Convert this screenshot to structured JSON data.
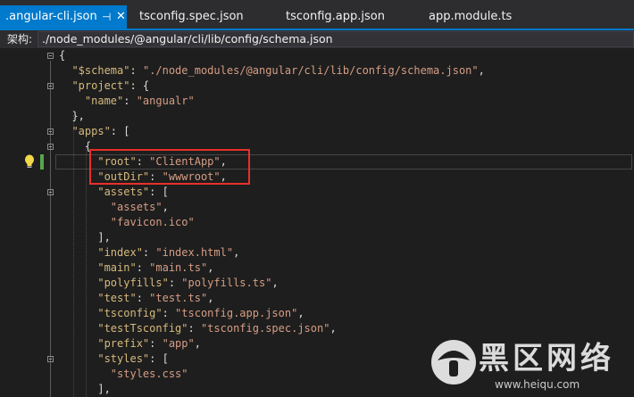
{
  "tabs": [
    {
      "label": ".angular-cli.json",
      "active": true,
      "pin_icon": "pin-icon",
      "close_icon": "close-icon"
    },
    {
      "label": "tsconfig.spec.json",
      "active": false
    },
    {
      "label": "tsconfig.app.json",
      "active": false
    },
    {
      "label": "app.module.ts",
      "active": false
    }
  ],
  "pathbar": {
    "label": "架构:",
    "value": "./node_modules/@angular/cli/lib/config/schema.json"
  },
  "code_lines": [
    {
      "parts": [
        [
          "punc",
          "{"
        ]
      ]
    },
    {
      "parts": [
        [
          "key",
          "  \"$schema\""
        ],
        [
          "punc",
          ": "
        ],
        [
          "str",
          "\"./node_modules/@angular/cli/lib/config/schema.json\""
        ],
        [
          "punc",
          ","
        ]
      ]
    },
    {
      "parts": [
        [
          "key",
          "  \"project\""
        ],
        [
          "punc",
          ": {"
        ]
      ]
    },
    {
      "parts": [
        [
          "key",
          "    \"name\""
        ],
        [
          "punc",
          ": "
        ],
        [
          "str",
          "\"angualr\""
        ]
      ]
    },
    {
      "parts": [
        [
          "punc",
          "  },"
        ]
      ]
    },
    {
      "parts": [
        [
          "key",
          "  \"apps\""
        ],
        [
          "punc",
          ": ["
        ]
      ]
    },
    {
      "parts": [
        [
          "punc",
          "    {"
        ]
      ]
    },
    {
      "parts": [
        [
          "key",
          "      \"root\""
        ],
        [
          "punc",
          ": "
        ],
        [
          "str",
          "\"ClientApp\""
        ],
        [
          "punc",
          ","
        ]
      ]
    },
    {
      "parts": [
        [
          "key",
          "      \"outDir\""
        ],
        [
          "punc",
          ": "
        ],
        [
          "str",
          "\"wwwroot\""
        ],
        [
          "punc",
          ","
        ]
      ]
    },
    {
      "parts": [
        [
          "key",
          "      \"assets\""
        ],
        [
          "punc",
          ": ["
        ]
      ]
    },
    {
      "parts": [
        [
          "str",
          "        \"assets\""
        ],
        [
          "punc",
          ","
        ]
      ]
    },
    {
      "parts": [
        [
          "str",
          "        \"favicon.ico\""
        ]
      ]
    },
    {
      "parts": [
        [
          "punc",
          "      ],"
        ]
      ]
    },
    {
      "parts": [
        [
          "key",
          "      \"index\""
        ],
        [
          "punc",
          ": "
        ],
        [
          "str",
          "\"index.html\""
        ],
        [
          "punc",
          ","
        ]
      ]
    },
    {
      "parts": [
        [
          "key",
          "      \"main\""
        ],
        [
          "punc",
          ": "
        ],
        [
          "str",
          "\"main.ts\""
        ],
        [
          "punc",
          ","
        ]
      ]
    },
    {
      "parts": [
        [
          "key",
          "      \"polyfills\""
        ],
        [
          "punc",
          ": "
        ],
        [
          "str",
          "\"polyfills.ts\""
        ],
        [
          "punc",
          ","
        ]
      ]
    },
    {
      "parts": [
        [
          "key",
          "      \"test\""
        ],
        [
          "punc",
          ": "
        ],
        [
          "str",
          "\"test.ts\""
        ],
        [
          "punc",
          ","
        ]
      ]
    },
    {
      "parts": [
        [
          "key",
          "      \"tsconfig\""
        ],
        [
          "punc",
          ": "
        ],
        [
          "str",
          "\"tsconfig.app.json\""
        ],
        [
          "punc",
          ","
        ]
      ]
    },
    {
      "parts": [
        [
          "key",
          "      \"testTsconfig\""
        ],
        [
          "punc",
          ": "
        ],
        [
          "str",
          "\"tsconfig.spec.json\""
        ],
        [
          "punc",
          ","
        ]
      ]
    },
    {
      "parts": [
        [
          "key",
          "      \"prefix\""
        ],
        [
          "punc",
          ": "
        ],
        [
          "str",
          "\"app\""
        ],
        [
          "punc",
          ","
        ]
      ]
    },
    {
      "parts": [
        [
          "key",
          "      \"styles\""
        ],
        [
          "punc",
          ": ["
        ]
      ]
    },
    {
      "parts": [
        [
          "str",
          "        \"styles.css\""
        ]
      ]
    },
    {
      "parts": [
        [
          "punc",
          "      ],"
        ]
      ]
    }
  ],
  "watermark": {
    "text": "黑区网络",
    "url": "www.heiqu.com"
  },
  "colors": {
    "accent": "#007acc",
    "highlight_box": "#e8302a",
    "key": "#d7ba7d",
    "string": "#d69d85"
  },
  "icons": {
    "lightbulb": "lightbulb-icon",
    "fold": "collapse-toggle-icon"
  }
}
